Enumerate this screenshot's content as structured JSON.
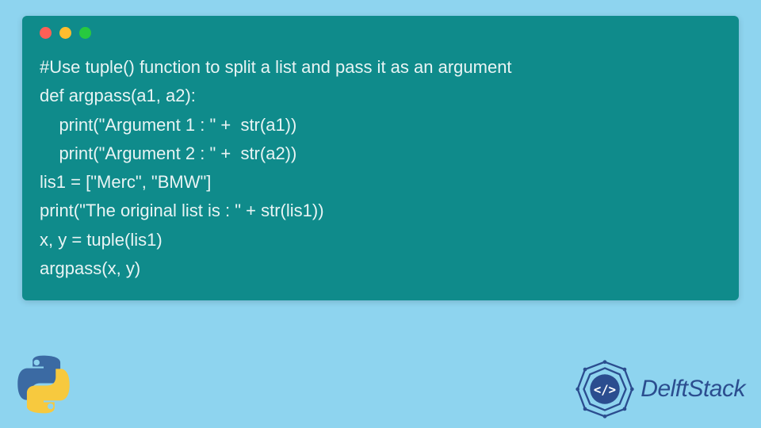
{
  "code": {
    "lines": [
      "#Use tuple() function to split a list and pass it as an argument",
      "def argpass(a1, a2):",
      "    print(\"Argument 1 : \" +  str(a1))",
      "    print(\"Argument 2 : \" +  str(a2))",
      "lis1 = [\"Merc\", \"BMW\"]",
      "print(\"The original list is : \" + str(lis1))",
      "x, y = tuple(lis1)",
      "argpass(x, y)"
    ]
  },
  "brand": {
    "name": "DelftStack"
  },
  "colors": {
    "background": "#8ed4ef",
    "window": "#0f8b8b",
    "text": "#e8f4f4",
    "brand": "#2b4d8f"
  }
}
